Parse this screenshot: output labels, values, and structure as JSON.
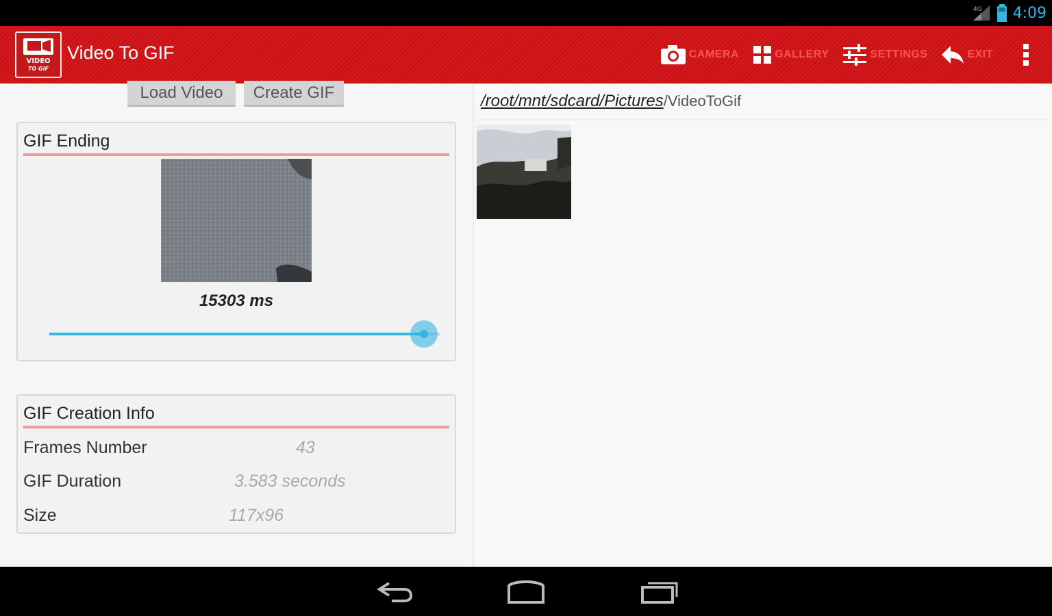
{
  "status_bar": {
    "time": "4:09"
  },
  "app": {
    "title": "Video To GIF",
    "icon_text_top": "VIDEO",
    "icon_text_bottom": "TO GIF"
  },
  "actions": [
    {
      "label": "CAMERA",
      "icon": "camera-icon"
    },
    {
      "label": "GALLERY",
      "icon": "grid-icon"
    },
    {
      "label": "SETTINGS",
      "icon": "sliders-icon"
    },
    {
      "label": "EXIT",
      "icon": "back-arrow-icon"
    }
  ],
  "buttons": {
    "load_video": "Load Video",
    "create_gif": "Create GIF"
  },
  "gif_ending": {
    "title": "GIF Ending",
    "duration_text": "15303 ms",
    "slider_fraction": 0.96
  },
  "gif_info": {
    "title": "GIF Creation Info",
    "rows": [
      {
        "label": "Frames Number",
        "value": "43"
      },
      {
        "label": "GIF Duration",
        "value": "3.583 seconds"
      },
      {
        "label": "Size",
        "value": "117x96"
      }
    ]
  },
  "browser": {
    "path_link": "/root/mnt/sdcard/Pictures",
    "path_rest": "/VideoToGif"
  }
}
